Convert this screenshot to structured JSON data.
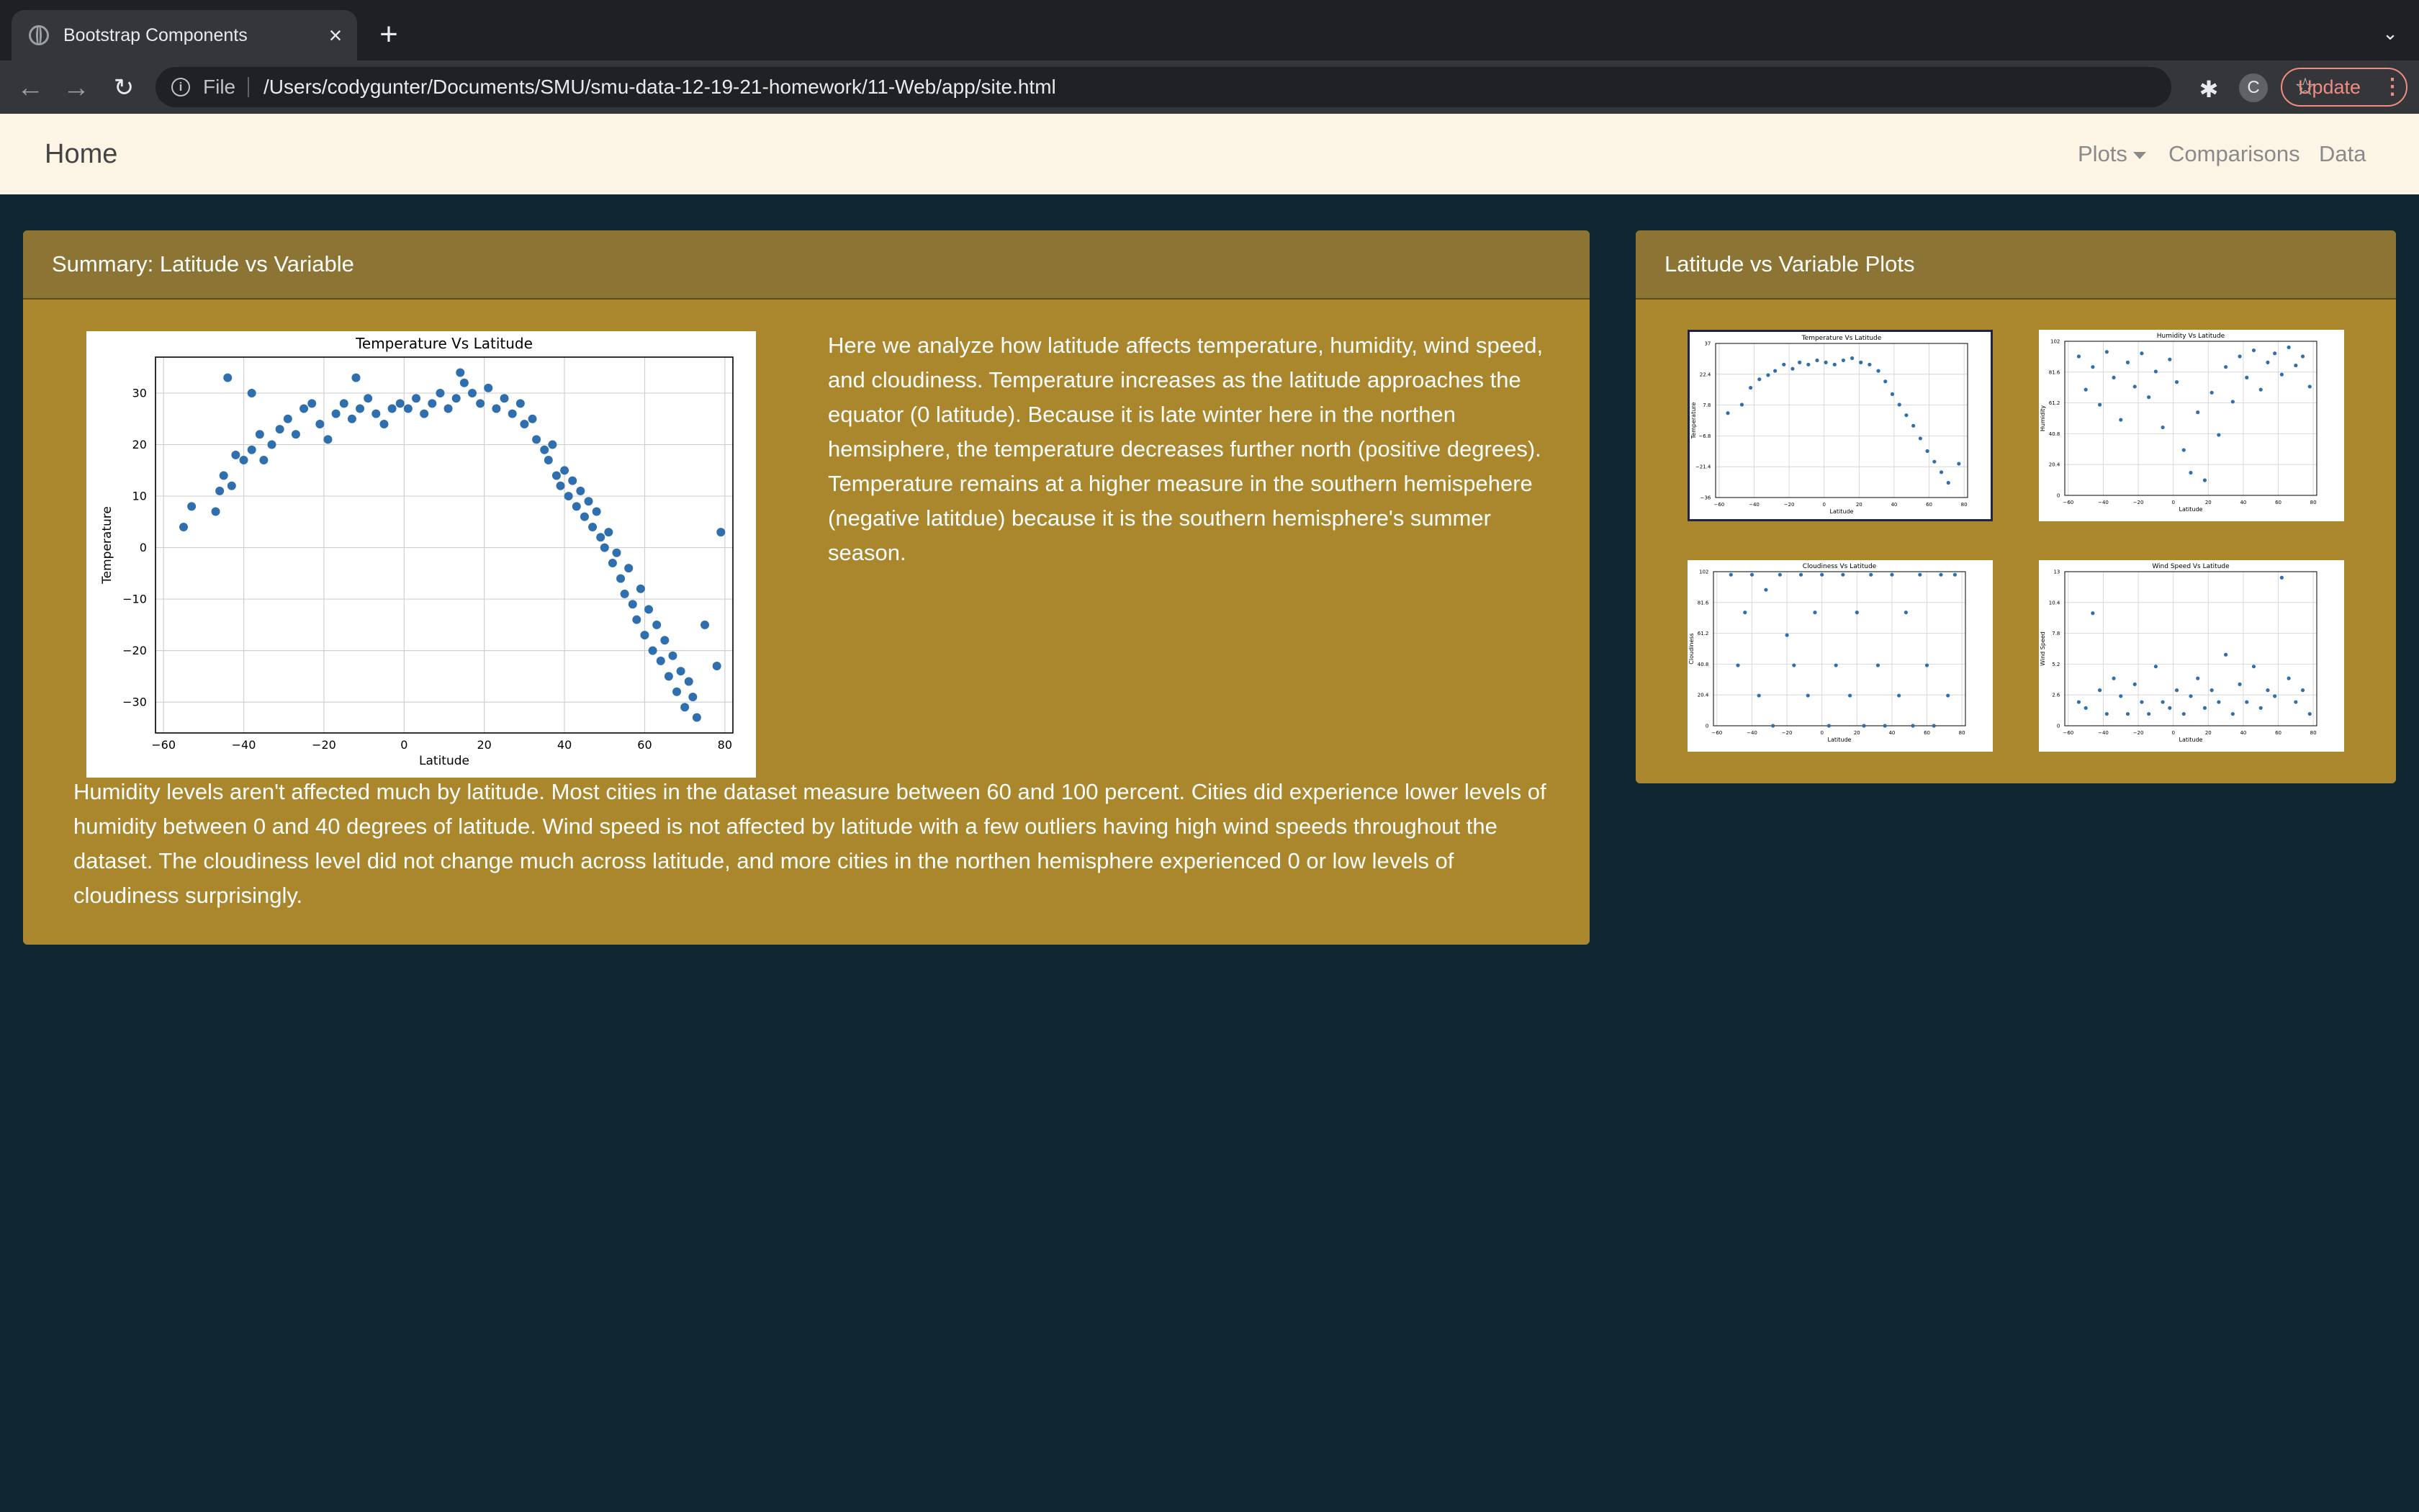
{
  "browser": {
    "tab_title": "Bootstrap Components",
    "url_scheme": "File",
    "url": "/Users/codygunter/Documents/SMU/smu-data-12-19-21-homework/11-Web/app/site.html",
    "update_label": "Update",
    "profile_initial": "C"
  },
  "navbar": {
    "brand": "Home",
    "links": [
      "Plots",
      "Comparisons",
      "Data"
    ]
  },
  "summary": {
    "header": "Summary: Latitude vs Variable",
    "paragraph_1": "Here we analyze how latitude affects temperature, humidity, wind speed, and cloudiness. Temperature increases as the latitude approaches the equator (0 latitude). Because it is late winter here in the northen hemsiphere, the temperature decreases further north (positive degrees). Temperature remains at a higher measure in the southern hemispehere (negative latitdue) because it is the southern hemisphere's summer season.",
    "paragraph_2": "Humidity levels aren't affected much by latitude. Most cities in the dataset measure between 60 and 100 percent. Cities did experience lower levels of humidity between 0 and 40 degrees of latitude. Wind speed is not affected by latitude with a few outliers having high wind speeds throughout the dataset. The cloudiness level did not change much across latitude, and more cities in the northen hemisphere experienced 0 or low levels of cloudiness surprisingly."
  },
  "plots_panel": {
    "header": "Latitude vs Variable Plots"
  },
  "colors": {
    "page_bg": "#0e2733",
    "panel_bg": "#aa872c",
    "panel_header_bg": "#8b7434",
    "navbar_bg": "#fcf4e4",
    "marker": "#2f6fae"
  },
  "chart_data": [
    {
      "type": "scatter",
      "title": "Temperature Vs Latitude",
      "xlabel": "Latitude",
      "ylabel": "Temperature",
      "xlim": [
        -62,
        82
      ],
      "ylim": [
        -36,
        37
      ],
      "xticks": [
        -60,
        -40,
        -20,
        0,
        20,
        40,
        60,
        80
      ],
      "yticks": [
        30,
        20,
        10,
        0,
        -10,
        -20,
        -30
      ],
      "grid": true,
      "points": [
        [
          -55,
          4
        ],
        [
          -53,
          8
        ],
        [
          -47,
          7
        ],
        [
          -46,
          11
        ],
        [
          -45,
          14
        ],
        [
          -43,
          12
        ],
        [
          -42,
          18
        ],
        [
          -40,
          17
        ],
        [
          -38,
          19
        ],
        [
          -36,
          22
        ],
        [
          -35,
          17
        ],
        [
          -33,
          20
        ],
        [
          -31,
          23
        ],
        [
          -29,
          25
        ],
        [
          -27,
          22
        ],
        [
          -25,
          27
        ],
        [
          -23,
          28
        ],
        [
          -21,
          24
        ],
        [
          -19,
          21
        ],
        [
          -17,
          26
        ],
        [
          -15,
          28
        ],
        [
          -13,
          25
        ],
        [
          -11,
          27
        ],
        [
          -9,
          29
        ],
        [
          -7,
          26
        ],
        [
          -5,
          24
        ],
        [
          -3,
          27
        ],
        [
          -1,
          28
        ],
        [
          1,
          27
        ],
        [
          3,
          29
        ],
        [
          5,
          26
        ],
        [
          7,
          28
        ],
        [
          9,
          30
        ],
        [
          11,
          27
        ],
        [
          13,
          29
        ],
        [
          15,
          32
        ],
        [
          17,
          30
        ],
        [
          19,
          28
        ],
        [
          21,
          31
        ],
        [
          23,
          27
        ],
        [
          25,
          29
        ],
        [
          27,
          26
        ],
        [
          29,
          28
        ],
        [
          30,
          24
        ],
        [
          32,
          25
        ],
        [
          33,
          21
        ],
        [
          35,
          19
        ],
        [
          36,
          17
        ],
        [
          37,
          20
        ],
        [
          38,
          14
        ],
        [
          39,
          12
        ],
        [
          40,
          15
        ],
        [
          41,
          10
        ],
        [
          42,
          13
        ],
        [
          43,
          8
        ],
        [
          44,
          11
        ],
        [
          45,
          6
        ],
        [
          46,
          9
        ],
        [
          47,
          4
        ],
        [
          48,
          7
        ],
        [
          49,
          2
        ],
        [
          50,
          0
        ],
        [
          51,
          3
        ],
        [
          52,
          -3
        ],
        [
          53,
          -1
        ],
        [
          54,
          -6
        ],
        [
          55,
          -9
        ],
        [
          56,
          -4
        ],
        [
          57,
          -11
        ],
        [
          58,
          -14
        ],
        [
          59,
          -8
        ],
        [
          60,
          -17
        ],
        [
          61,
          -12
        ],
        [
          62,
          -20
        ],
        [
          63,
          -15
        ],
        [
          64,
          -22
        ],
        [
          65,
          -18
        ],
        [
          66,
          -25
        ],
        [
          67,
          -21
        ],
        [
          68,
          -28
        ],
        [
          69,
          -24
        ],
        [
          70,
          -31
        ],
        [
          71,
          -26
        ],
        [
          72,
          -29
        ],
        [
          73,
          -33
        ],
        [
          75,
          -15
        ],
        [
          78,
          -23
        ],
        [
          79,
          3
        ],
        [
          -44,
          33
        ],
        [
          -38,
          30
        ],
        [
          -12,
          33
        ],
        [
          14,
          34
        ]
      ]
    },
    {
      "type": "scatter",
      "title": "Temperature Vs Latitude",
      "xlabel": "Latitude",
      "ylabel": "Temperature",
      "xlim": [
        -62,
        82
      ],
      "ylim": [
        -36,
        37
      ],
      "points": [
        [
          -55,
          4
        ],
        [
          -47,
          8
        ],
        [
          -42,
          16
        ],
        [
          -37,
          20
        ],
        [
          -32,
          22
        ],
        [
          -28,
          24
        ],
        [
          -23,
          27
        ],
        [
          -18,
          25
        ],
        [
          -14,
          28
        ],
        [
          -9,
          27
        ],
        [
          -4,
          29
        ],
        [
          1,
          28
        ],
        [
          6,
          27
        ],
        [
          11,
          29
        ],
        [
          16,
          30
        ],
        [
          21,
          28
        ],
        [
          26,
          27
        ],
        [
          31,
          24
        ],
        [
          35,
          19
        ],
        [
          39,
          13
        ],
        [
          43,
          8
        ],
        [
          47,
          3
        ],
        [
          51,
          -2
        ],
        [
          55,
          -8
        ],
        [
          59,
          -14
        ],
        [
          63,
          -19
        ],
        [
          67,
          -24
        ],
        [
          71,
          -29
        ],
        [
          77,
          -20
        ]
      ]
    },
    {
      "type": "scatter",
      "title": "Humidity Vs Latitude",
      "xlabel": "Latitude",
      "ylabel": "Humidity",
      "xlim": [
        -62,
        82
      ],
      "ylim": [
        0,
        102
      ],
      "points": [
        [
          -54,
          92
        ],
        [
          -50,
          70
        ],
        [
          -46,
          85
        ],
        [
          -42,
          60
        ],
        [
          -38,
          95
        ],
        [
          -34,
          78
        ],
        [
          -30,
          50
        ],
        [
          -26,
          88
        ],
        [
          -22,
          72
        ],
        [
          -18,
          94
        ],
        [
          -14,
          65
        ],
        [
          -10,
          82
        ],
        [
          -6,
          45
        ],
        [
          -2,
          90
        ],
        [
          2,
          75
        ],
        [
          6,
          30
        ],
        [
          10,
          15
        ],
        [
          14,
          55
        ],
        [
          18,
          10
        ],
        [
          22,
          68
        ],
        [
          26,
          40
        ],
        [
          30,
          85
        ],
        [
          34,
          62
        ],
        [
          38,
          92
        ],
        [
          42,
          78
        ],
        [
          46,
          96
        ],
        [
          50,
          70
        ],
        [
          54,
          88
        ],
        [
          58,
          94
        ],
        [
          62,
          80
        ],
        [
          66,
          98
        ],
        [
          70,
          86
        ],
        [
          74,
          92
        ],
        [
          78,
          72
        ]
      ]
    },
    {
      "type": "scatter",
      "title": "Cloudiness Vs Latitude",
      "xlabel": "Latitude",
      "ylabel": "Cloudiness",
      "xlim": [
        -62,
        82
      ],
      "ylim": [
        0,
        102
      ],
      "points": [
        [
          -52,
          100
        ],
        [
          -48,
          40
        ],
        [
          -44,
          75
        ],
        [
          -40,
          100
        ],
        [
          -36,
          20
        ],
        [
          -32,
          90
        ],
        [
          -28,
          0
        ],
        [
          -24,
          100
        ],
        [
          -20,
          60
        ],
        [
          -16,
          40
        ],
        [
          -12,
          100
        ],
        [
          -8,
          20
        ],
        [
          -4,
          75
        ],
        [
          0,
          100
        ],
        [
          4,
          0
        ],
        [
          8,
          40
        ],
        [
          12,
          100
        ],
        [
          16,
          20
        ],
        [
          20,
          75
        ],
        [
          24,
          0
        ],
        [
          28,
          100
        ],
        [
          32,
          40
        ],
        [
          36,
          0
        ],
        [
          40,
          100
        ],
        [
          44,
          20
        ],
        [
          48,
          75
        ],
        [
          52,
          0
        ],
        [
          56,
          100
        ],
        [
          60,
          40
        ],
        [
          64,
          0
        ],
        [
          68,
          100
        ],
        [
          72,
          20
        ],
        [
          76,
          100
        ]
      ]
    },
    {
      "type": "scatter",
      "title": "Wind Speed Vs Latitude",
      "xlabel": "Latitude",
      "ylabel": "Wind Speed",
      "xlim": [
        -62,
        82
      ],
      "ylim": [
        0,
        13
      ],
      "points": [
        [
          -54,
          2
        ],
        [
          -50,
          1.5
        ],
        [
          -46,
          9.5
        ],
        [
          -42,
          3
        ],
        [
          -38,
          1
        ],
        [
          -34,
          4
        ],
        [
          -30,
          2.5
        ],
        [
          -26,
          1
        ],
        [
          -22,
          3.5
        ],
        [
          -18,
          2
        ],
        [
          -14,
          1
        ],
        [
          -10,
          5
        ],
        [
          -6,
          2
        ],
        [
          -2,
          1.5
        ],
        [
          2,
          3
        ],
        [
          6,
          1
        ],
        [
          10,
          2.5
        ],
        [
          14,
          4
        ],
        [
          18,
          1.5
        ],
        [
          22,
          3
        ],
        [
          26,
          2
        ],
        [
          30,
          6
        ],
        [
          34,
          1
        ],
        [
          38,
          3.5
        ],
        [
          42,
          2
        ],
        [
          46,
          5
        ],
        [
          50,
          1.5
        ],
        [
          54,
          3
        ],
        [
          58,
          2.5
        ],
        [
          62,
          12.5
        ],
        [
          66,
          4
        ],
        [
          70,
          2
        ],
        [
          74,
          3
        ],
        [
          78,
          1
        ]
      ]
    }
  ]
}
